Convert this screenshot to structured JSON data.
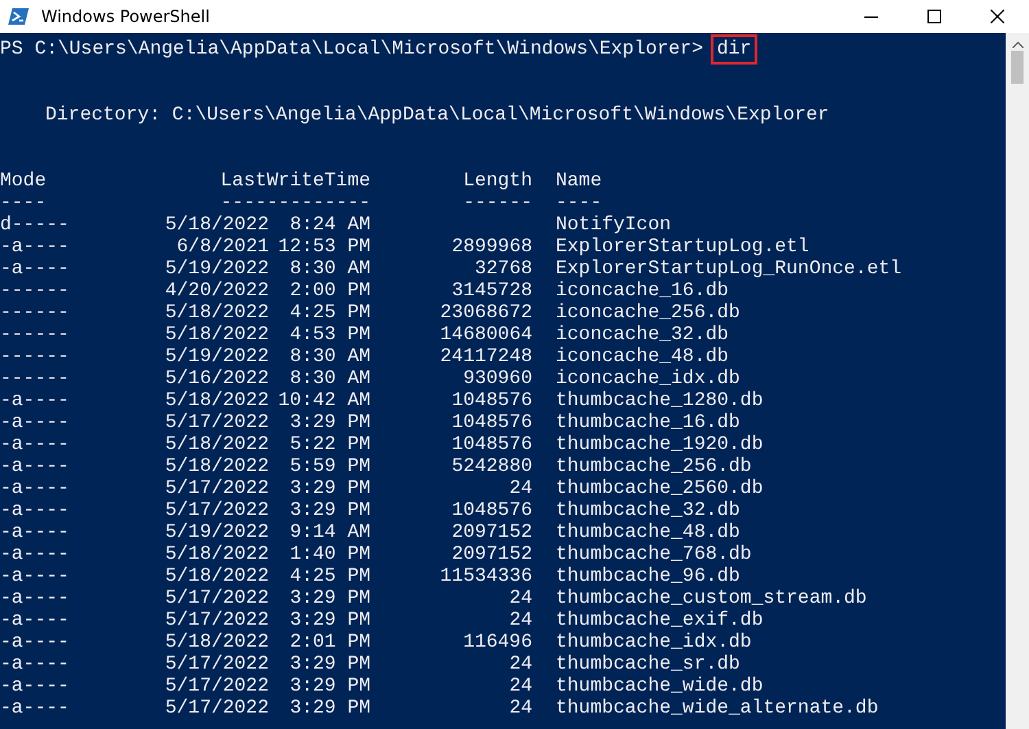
{
  "window": {
    "title": "Windows PowerShell"
  },
  "prompt": {
    "path": "PS C:\\Users\\Angelia\\AppData\\Local\\Microsoft\\Windows\\Explorer>",
    "command": "dir",
    "highlighted": true
  },
  "directory": "Directory: C:\\Users\\Angelia\\AppData\\Local\\Microsoft\\Windows\\Explorer",
  "columns": [
    "Mode",
    "LastWriteTime",
    "Length",
    "Name"
  ],
  "separators": [
    "----",
    "-------------",
    "------",
    "----"
  ],
  "rows": [
    {
      "mode": "d-----",
      "date": "5/18/2022",
      "time": "8:24 AM",
      "length": "",
      "name": "NotifyIcon"
    },
    {
      "mode": "-a----",
      "date": "6/8/2021",
      "time": "12:53 PM",
      "length": "2899968",
      "name": "ExplorerStartupLog.etl"
    },
    {
      "mode": "-a----",
      "date": "5/19/2022",
      "time": "8:30 AM",
      "length": "32768",
      "name": "ExplorerStartupLog_RunOnce.etl"
    },
    {
      "mode": "------",
      "date": "4/20/2022",
      "time": "2:00 PM",
      "length": "3145728",
      "name": "iconcache_16.db"
    },
    {
      "mode": "------",
      "date": "5/18/2022",
      "time": "4:25 PM",
      "length": "23068672",
      "name": "iconcache_256.db"
    },
    {
      "mode": "------",
      "date": "5/18/2022",
      "time": "4:53 PM",
      "length": "14680064",
      "name": "iconcache_32.db"
    },
    {
      "mode": "------",
      "date": "5/19/2022",
      "time": "8:30 AM",
      "length": "24117248",
      "name": "iconcache_48.db"
    },
    {
      "mode": "------",
      "date": "5/16/2022",
      "time": "8:30 AM",
      "length": "930960",
      "name": "iconcache_idx.db"
    },
    {
      "mode": "-a----",
      "date": "5/18/2022",
      "time": "10:42 AM",
      "length": "1048576",
      "name": "thumbcache_1280.db"
    },
    {
      "mode": "-a----",
      "date": "5/17/2022",
      "time": "3:29 PM",
      "length": "1048576",
      "name": "thumbcache_16.db"
    },
    {
      "mode": "-a----",
      "date": "5/18/2022",
      "time": "5:22 PM",
      "length": "1048576",
      "name": "thumbcache_1920.db"
    },
    {
      "mode": "-a----",
      "date": "5/18/2022",
      "time": "5:59 PM",
      "length": "5242880",
      "name": "thumbcache_256.db"
    },
    {
      "mode": "-a----",
      "date": "5/17/2022",
      "time": "3:29 PM",
      "length": "24",
      "name": "thumbcache_2560.db"
    },
    {
      "mode": "-a----",
      "date": "5/17/2022",
      "time": "3:29 PM",
      "length": "1048576",
      "name": "thumbcache_32.db"
    },
    {
      "mode": "-a----",
      "date": "5/19/2022",
      "time": "9:14 AM",
      "length": "2097152",
      "name": "thumbcache_48.db"
    },
    {
      "mode": "-a----",
      "date": "5/18/2022",
      "time": "1:40 PM",
      "length": "2097152",
      "name": "thumbcache_768.db"
    },
    {
      "mode": "-a----",
      "date": "5/18/2022",
      "time": "4:25 PM",
      "length": "11534336",
      "name": "thumbcache_96.db"
    },
    {
      "mode": "-a----",
      "date": "5/17/2022",
      "time": "3:29 PM",
      "length": "24",
      "name": "thumbcache_custom_stream.db"
    },
    {
      "mode": "-a----",
      "date": "5/17/2022",
      "time": "3:29 PM",
      "length": "24",
      "name": "thumbcache_exif.db"
    },
    {
      "mode": "-a----",
      "date": "5/18/2022",
      "time": "2:01 PM",
      "length": "116496",
      "name": "thumbcache_idx.db"
    },
    {
      "mode": "-a----",
      "date": "5/17/2022",
      "time": "3:29 PM",
      "length": "24",
      "name": "thumbcache_sr.db"
    },
    {
      "mode": "-a----",
      "date": "5/17/2022",
      "time": "3:29 PM",
      "length": "24",
      "name": "thumbcache_wide.db"
    },
    {
      "mode": "-a----",
      "date": "5/17/2022",
      "time": "3:29 PM",
      "length": "24",
      "name": "thumbcache_wide_alternate.db"
    }
  ]
}
